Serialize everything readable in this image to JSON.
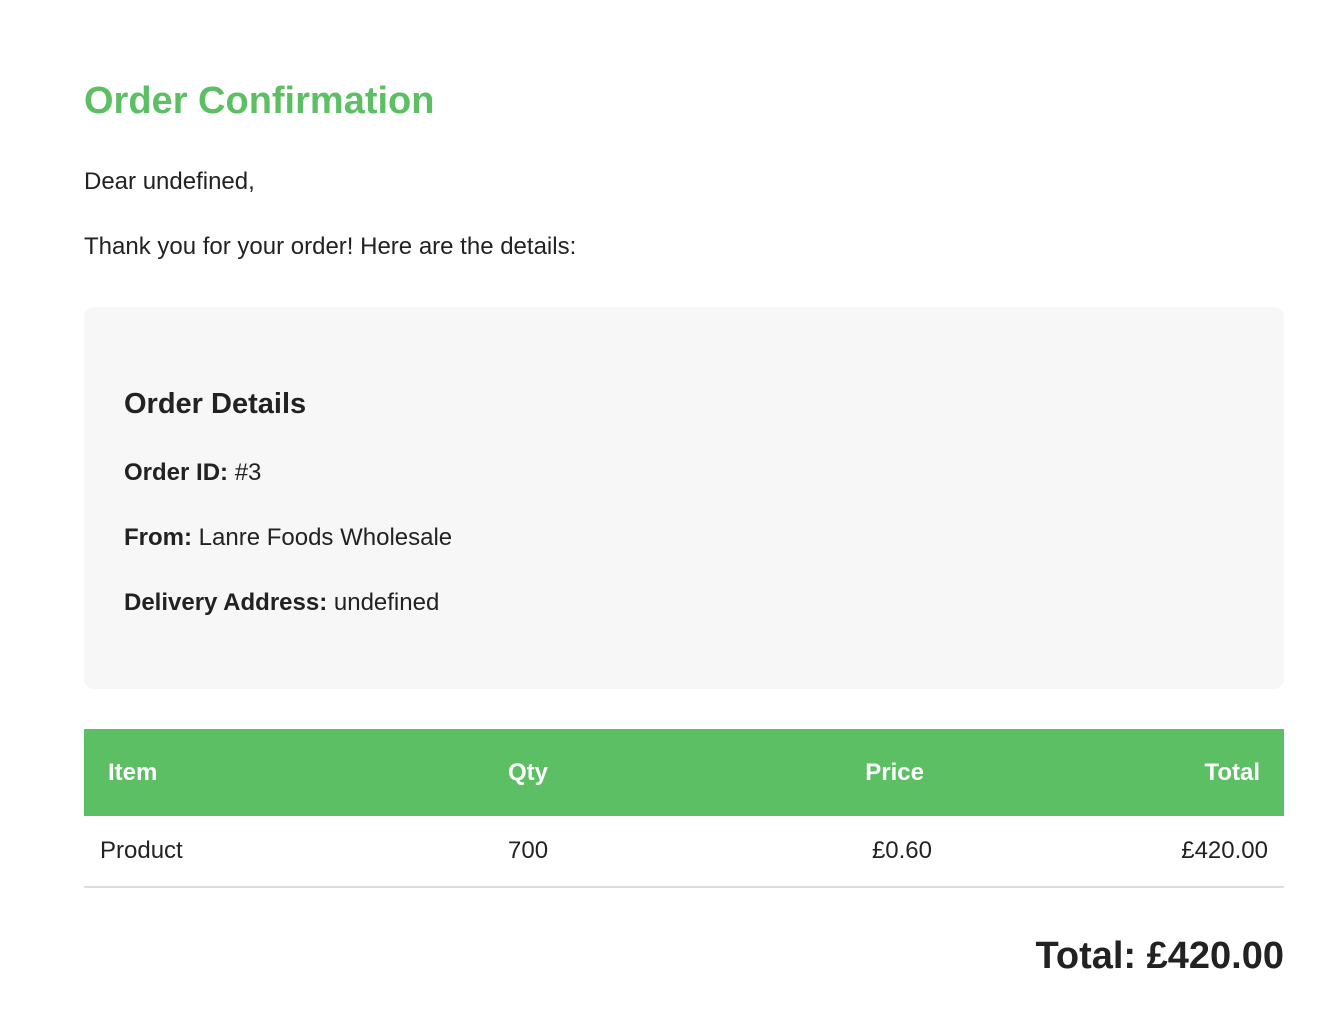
{
  "email": {
    "title": "Order Confirmation",
    "greeting": "Dear undefined,",
    "intro": "Thank you for your order! Here are the details:"
  },
  "details": {
    "heading": "Order Details",
    "order_id_label": "Order ID:",
    "order_id_value": "#3",
    "from_label": "From:",
    "from_value": "Lanre Foods Wholesale",
    "address_label": "Delivery Address:",
    "address_value": "undefined"
  },
  "table": {
    "headers": {
      "item": "Item",
      "qty": "Qty",
      "price": "Price",
      "total": "Total"
    },
    "rows": [
      {
        "item": "Product",
        "qty": "700",
        "price": "£0.60",
        "total": "£420.00"
      }
    ]
  },
  "summary": {
    "total": "Total: £420.00"
  },
  "colors": {
    "accent": "#5cbf63",
    "panel_background": "#f7f7f7",
    "text": "#222222"
  }
}
